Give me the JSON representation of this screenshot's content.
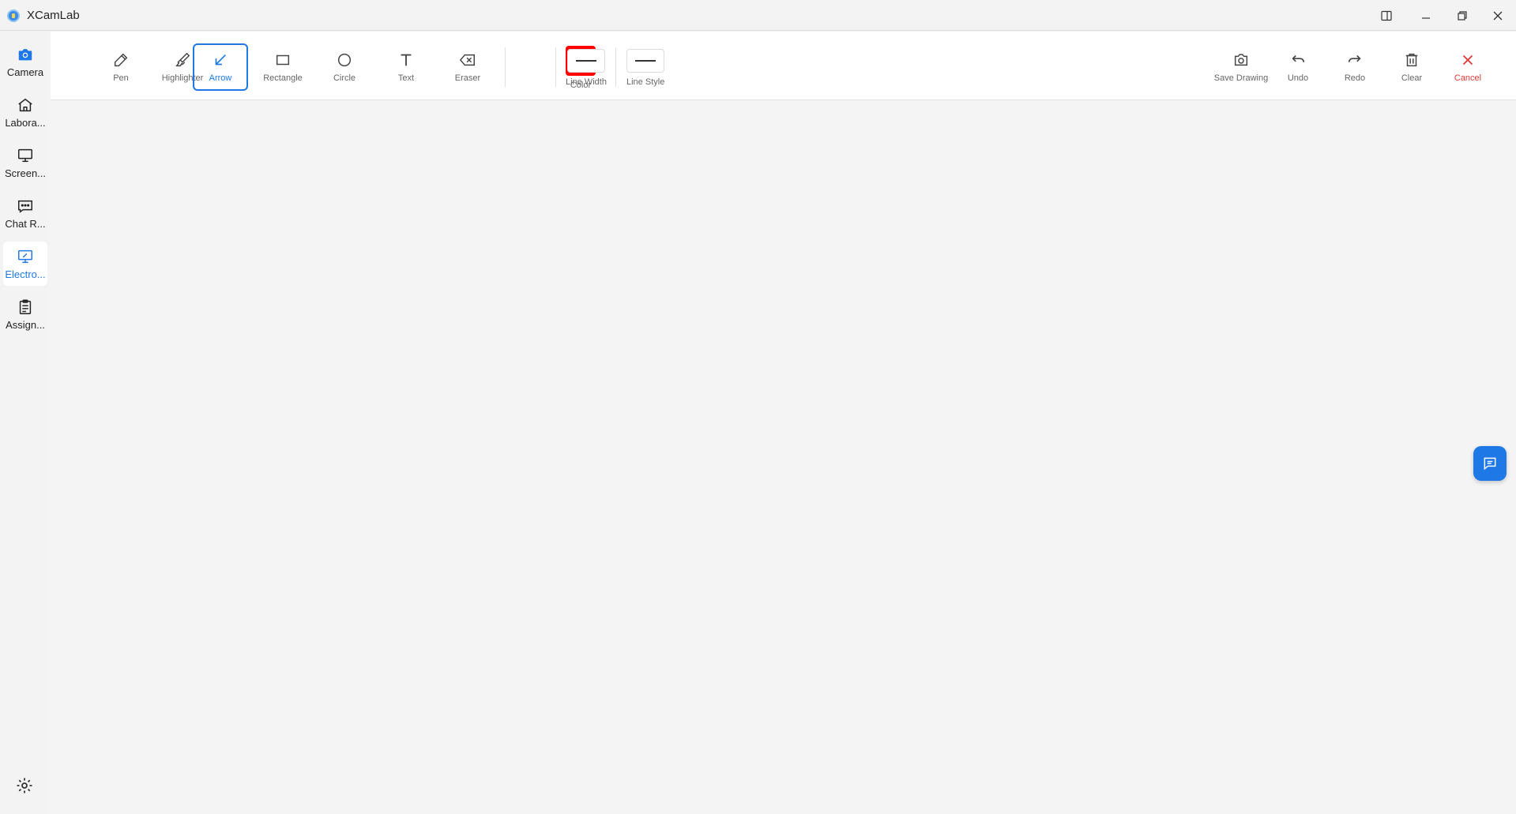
{
  "window": {
    "title": "XCamLab"
  },
  "sidebar": {
    "items": [
      {
        "label": "Camera",
        "icon": "camera-icon"
      },
      {
        "label": "Labora...",
        "icon": "home-icon"
      },
      {
        "label": "Screen...",
        "icon": "monitor-icon"
      },
      {
        "label": "Chat R...",
        "icon": "chat-icon"
      },
      {
        "label": "Electro...",
        "icon": "whiteboard-icon",
        "active": true
      },
      {
        "label": "Assign...",
        "icon": "clipboard-icon"
      }
    ],
    "settings_icon": "gear-icon"
  },
  "toolbar": {
    "tools": [
      {
        "label": "Pen",
        "icon": "pen-icon"
      },
      {
        "label": "Highlighter",
        "icon": "highlighter-icon"
      },
      {
        "label": "Arrow",
        "icon": "arrow-icon",
        "active": true
      },
      {
        "label": "Rectangle",
        "icon": "rectangle-icon"
      },
      {
        "label": "Circle",
        "icon": "circle-icon"
      },
      {
        "label": "Text",
        "icon": "text-icon"
      },
      {
        "label": "Eraser",
        "icon": "eraser-icon"
      }
    ],
    "color": {
      "label": "Color",
      "value": "#ff0000"
    },
    "line_width": {
      "label": "Line Width"
    },
    "line_style": {
      "label": "Line Style"
    },
    "actions": [
      {
        "label": "Save Drawing",
        "icon": "camera-icon"
      },
      {
        "label": "Undo",
        "icon": "undo-icon"
      },
      {
        "label": "Redo",
        "icon": "redo-icon"
      },
      {
        "label": "Clear",
        "icon": "trash-icon"
      },
      {
        "label": "Cancel",
        "icon": "close-icon"
      }
    ]
  },
  "colors": {
    "accent": "#1e78e6",
    "danger": "#e53935"
  }
}
